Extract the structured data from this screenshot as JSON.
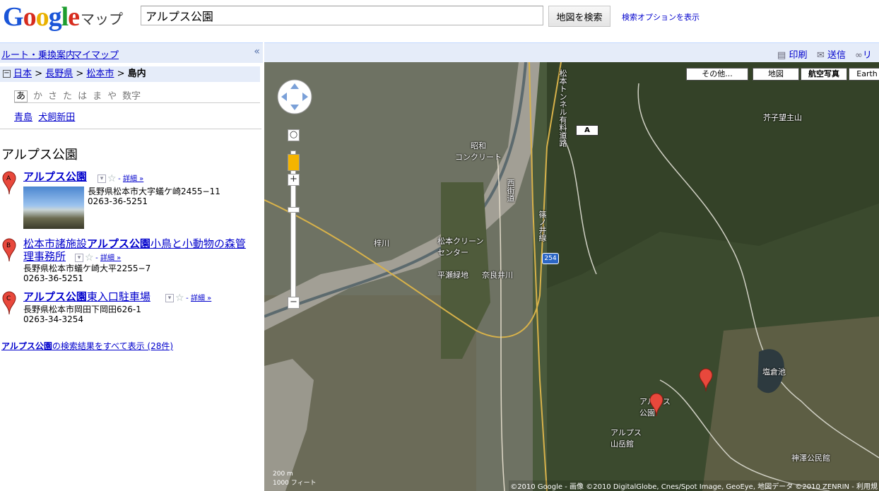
{
  "header": {
    "logo": "Google",
    "logo_sub": "マップ",
    "search_value": "アルプス公園",
    "search_button": "地図を検索",
    "search_options": "検索オプションを表示"
  },
  "left_toolbar": {
    "route": "ルート・乗換案内",
    "mymap": "マイマップ",
    "collapse": "«"
  },
  "breadcrumb": {
    "items": [
      "日本",
      "長野県",
      "松本市"
    ],
    "current": "島内",
    "sep": ">"
  },
  "kana": {
    "items": [
      "あ",
      "か",
      "さ",
      "た",
      "は",
      "ま",
      "や",
      "数字"
    ]
  },
  "places": [
    "青島",
    "犬飼新田"
  ],
  "results_title": "アルプス公園",
  "results": [
    {
      "marker": "A",
      "title_bold": "アルプス公園",
      "title_rest": "",
      "detail": "詳細 »",
      "address": "長野県松本市大字蟻ケ崎2455−11",
      "phone": "0263-36-5251"
    },
    {
      "marker": "B",
      "title_pre": "松本市諸施設",
      "title_bold": "アルプス公園",
      "title_rest": "小鳥と小動物の森管",
      "title_line2": "理事務所",
      "detail": "詳細 »",
      "address": "長野県松本市蟻ケ崎大平2255−7",
      "phone": "0263-36-5251"
    },
    {
      "marker": "C",
      "title_bold": "アルプス公園",
      "title_rest": "東入口駐車場",
      "detail": "詳細 »",
      "address": "長野県松本市岡田下岡田626-1",
      "phone": "0263-34-3254"
    }
  ],
  "all_results": {
    "bold": "アルプス公園",
    "text": "の検索結果をすべて表示 (28件)"
  },
  "map_toolbar": {
    "print": "印刷",
    "send": "送信",
    "link": "リン"
  },
  "map_types": [
    "その他...",
    "地図",
    "航空写真",
    "Earth"
  ],
  "map_type_selected": "航空写真",
  "map_labels": {
    "concrete": "昭和\nコンクリート",
    "azusa": "梓川",
    "clean_center": "松本クリーン\nセンター",
    "hirase": "平瀬緑地",
    "narai": "奈良井川",
    "karashi": "芥子望主山",
    "shiokura": "塩倉池",
    "kanzawa": "神澤公民館",
    "alps_sangaku": "アルプス\n山岳館",
    "alps_park": "アルプス\n公園",
    "route": "254",
    "nishi": "西街道",
    "shinonoi": "篠ノ井線",
    "tunnel": "松本トンネル有料道路",
    "marker_a_box": "A"
  },
  "scale": {
    "m": "200 m",
    "ft": "1000 フィート"
  },
  "copyright": "©2010 Google - 画像 ©2010 DigitalGlobe, Cnes/Spot Image, GeoEye, 地図データ ©2010 ZENRIN - 利用規"
}
